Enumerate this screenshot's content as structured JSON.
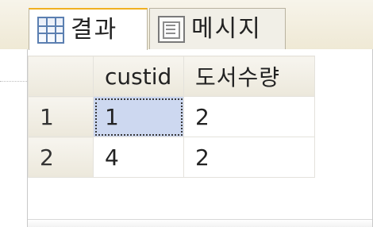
{
  "tabs": [
    {
      "label": "결과",
      "icon": "results-grid-icon",
      "selected": true
    },
    {
      "label": "메시지",
      "icon": "messages-icon",
      "selected": false
    }
  ],
  "results": {
    "columns": [
      "",
      "custid",
      "도서수량"
    ],
    "rows": [
      {
        "row_number": "1",
        "custid": "1",
        "book_count": "2"
      },
      {
        "row_number": "2",
        "custid": "4",
        "book_count": "2"
      }
    ]
  },
  "colors": {
    "selected_cell": "#cdd8f0",
    "active_tab_accent": "#f0b020",
    "header_background": "#ece8db"
  }
}
